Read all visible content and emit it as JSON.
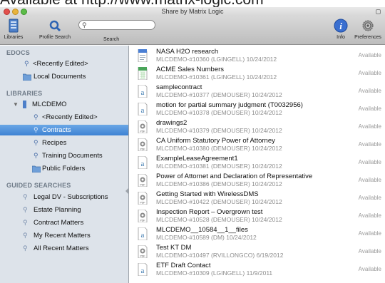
{
  "banner": {
    "text": "Available at http://www.matrix-logic.com"
  },
  "window": {
    "title": "Share by Matrix Logic"
  },
  "toolbar": {
    "libraries_label": "Libraries",
    "profile_search_label": "Profile Search",
    "search_label": "Search",
    "search_value": "",
    "info_label": "Info",
    "preferences_label": "Preferences"
  },
  "sidebar": {
    "edocs_header": "EDOCS",
    "edocs_recent": "<Recently Edited>",
    "local_documents": "Local Documents",
    "libraries_header": "LIBRARIES",
    "mlcdemo": "MLCDEMO",
    "lib_recent": "<Recently Edited>",
    "contracts": "Contracts",
    "recipes": "Recipes",
    "training_documents": "Training Documents",
    "public_folders": "Public Folders",
    "guided_header": "GUIDED SEARCHES",
    "guided": [
      "Legal DV - Subscriptions",
      "Estate Planning",
      "Contract Matters",
      "My Recent Matters",
      "All Recent Matters"
    ]
  },
  "documents": [
    {
      "title": "NASA H2O research",
      "meta": "MLCDEMO-#10360 (LGINGELL) 10/24/2012",
      "status": "Available",
      "icon": "word-doc-icon"
    },
    {
      "title": "ACME Sales Numbers",
      "meta": "MLCDEMO-#10361 (LGINGELL) 10/24/2012",
      "status": "Available",
      "icon": "spreadsheet-icon"
    },
    {
      "title": "samplecontract",
      "meta": "MLCDEMO-#10377 (DEMOUSER) 10/24/2012",
      "status": "Available",
      "icon": "text-doc-icon"
    },
    {
      "title": "motion for partial summary judgment (T0032956)",
      "meta": "MLCDEMO-#10378 (DEMOUSER) 10/24/2012",
      "status": "Available",
      "icon": "text-doc-icon"
    },
    {
      "title": "drawings2",
      "meta": "MLCDEMO-#10379 (DEMOUSER) 10/24/2012",
      "status": "Available",
      "icon": "pdf-icon"
    },
    {
      "title": "CA Uniform Statutory Power of Attorney",
      "meta": "MLCDEMO-#10380 (DEMOUSER) 10/24/2012",
      "status": "Available",
      "icon": "pdf-icon"
    },
    {
      "title": "ExampleLeaseAgreement1",
      "meta": "MLCDEMO-#10381 (DEMOUSER) 10/24/2012",
      "status": "Available",
      "icon": "text-doc-icon"
    },
    {
      "title": "Power of Attornet and Declaration of Representative",
      "meta": "MLCDEMO-#10386 (DEMOUSER) 10/24/2012",
      "status": "Available",
      "icon": "pdf-icon"
    },
    {
      "title": "Getting Started with WirelessDMS",
      "meta": "MLCDEMO-#10422 (DEMOUSER) 10/24/2012",
      "status": "Available",
      "icon": "pdf-icon"
    },
    {
      "title": "Inspection Report – Overgrown test",
      "meta": "MLCDEMO-#10528 (DEMOUSER) 10/24/2012",
      "status": "Available",
      "icon": "pdf-icon"
    },
    {
      "title": "MLCDEMO__10584__1__files",
      "meta": "MLCDEMO-#10589 (DM) 10/24/2012",
      "status": "Available",
      "icon": "text-doc-icon"
    },
    {
      "title": "Test KT DM",
      "meta": "MLCDEMO-#10497 (RVILLONGCO) 6/19/2012",
      "status": "Available",
      "icon": "pdf-icon"
    },
    {
      "title": "ETF Draft Contact",
      "meta": "MLCDEMO-#10309 (LGINGELL) 11/9/2011",
      "status": "Available",
      "icon": "text-doc-icon"
    }
  ]
}
